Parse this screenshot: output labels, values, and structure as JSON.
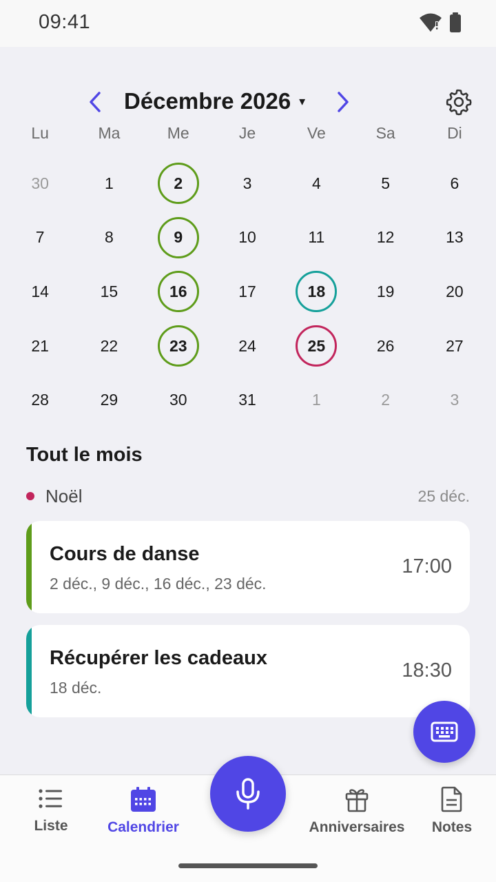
{
  "status_bar": {
    "time": "09:41",
    "icons": [
      "wifi-alert-icon",
      "battery-icon"
    ]
  },
  "calendar": {
    "month_label": "Décembre 2026",
    "caret": "▾",
    "weekdays": [
      "Lu",
      "Ma",
      "Me",
      "Je",
      "Ve",
      "Sa",
      "Di"
    ],
    "days": [
      {
        "label": "30",
        "muted": true
      },
      {
        "label": "1"
      },
      {
        "label": "2",
        "ring": "#5e9c1a"
      },
      {
        "label": "3"
      },
      {
        "label": "4"
      },
      {
        "label": "5"
      },
      {
        "label": "6"
      },
      {
        "label": "7"
      },
      {
        "label": "8"
      },
      {
        "label": "9",
        "ring": "#5e9c1a"
      },
      {
        "label": "10"
      },
      {
        "label": "11"
      },
      {
        "label": "12"
      },
      {
        "label": "13"
      },
      {
        "label": "14"
      },
      {
        "label": "15"
      },
      {
        "label": "16",
        "ring": "#5e9c1a"
      },
      {
        "label": "17"
      },
      {
        "label": "18",
        "ring": "#15a09a"
      },
      {
        "label": "19"
      },
      {
        "label": "20"
      },
      {
        "label": "21"
      },
      {
        "label": "22"
      },
      {
        "label": "23",
        "ring": "#5e9c1a"
      },
      {
        "label": "24"
      },
      {
        "label": "25",
        "ring": "#c2255c"
      },
      {
        "label": "26"
      },
      {
        "label": "27"
      },
      {
        "label": "28"
      },
      {
        "label": "29"
      },
      {
        "label": "30"
      },
      {
        "label": "31"
      },
      {
        "label": "1",
        "muted": true
      },
      {
        "label": "2",
        "muted": true
      },
      {
        "label": "3",
        "muted": true
      }
    ]
  },
  "month_section": {
    "title": "Tout le mois",
    "holiday": {
      "name": "Noël",
      "date": "25 déc.",
      "color": "#c2255c"
    },
    "events": [
      {
        "title": "Cours de danse",
        "dates": "2 déc., 9 déc., 16 déc., 23 déc.",
        "time": "17:00",
        "color": "#5e9c1a"
      },
      {
        "title": "Récupérer les cadeaux",
        "dates": "18 déc.",
        "time": "18:30",
        "color": "#15a09a"
      }
    ]
  },
  "bottom_nav": {
    "items": [
      {
        "label": "Liste",
        "icon": "list-icon"
      },
      {
        "label": "Calendrier",
        "icon": "calendar-icon",
        "active": true
      },
      {
        "label": "Anniversaires",
        "icon": "gift-icon"
      },
      {
        "label": "Notes",
        "icon": "note-icon"
      }
    ]
  },
  "colors": {
    "accent": "#5046e5",
    "dance": "#5e9c1a",
    "pickup": "#15a09a",
    "holiday": "#c2255c"
  }
}
